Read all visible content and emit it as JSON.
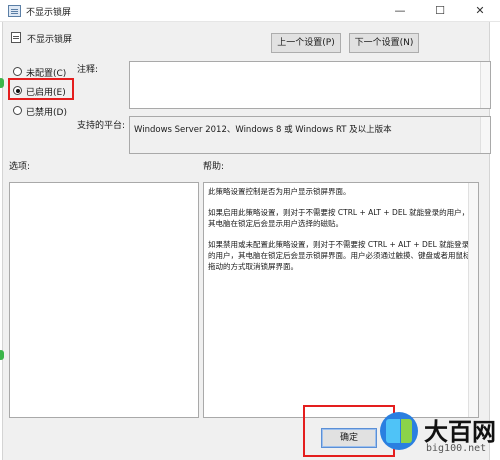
{
  "window": {
    "title": "不显示锁屏",
    "minimize": "—",
    "maximize": "☐",
    "close": "✕"
  },
  "header": {
    "setting_name": "不显示锁屏",
    "prev_button": "上一个设置(P)",
    "next_button": "下一个设置(N)"
  },
  "state_options": [
    {
      "label": "未配置(C)",
      "checked": false
    },
    {
      "label": "已启用(E)",
      "checked": true
    },
    {
      "label": "已禁用(D)",
      "checked": false
    }
  ],
  "comment": {
    "label": "注释:",
    "value": ""
  },
  "platform": {
    "label": "支持的平台:",
    "value": "Windows Server 2012、Windows 8 或 Windows RT 及以上版本"
  },
  "options_label": "选项:",
  "help": {
    "label": "帮助:",
    "paragraphs": [
      "此策略设置控制是否为用户显示锁屏界面。",
      "如果启用此策略设置，则对于不需要按 CTRL + ALT + DEL 就能登录的用户，其电脑在锁定后会显示用户选择的磁贴。",
      "如果禁用或未配置此策略设置，则对于不需要按 CTRL + ALT + DEL 就能登录的用户，其电脑在锁定后会显示锁屏界面。用户必须通过触摸、键盘或者用鼠标拖动的方式取消锁屏界面。"
    ]
  },
  "footer": {
    "ok_button": "确定"
  },
  "watermark": {
    "name": "大百网",
    "url": "big100.net"
  },
  "colors": {
    "highlight_box": "#e41e1e",
    "dialog_bg": "#f0f0f0"
  }
}
